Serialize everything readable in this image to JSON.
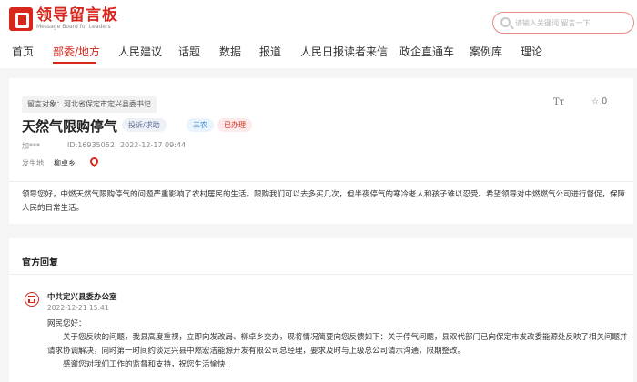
{
  "header": {
    "logo_title": "领导留言板",
    "logo_subtitle": "Message Board for Leaders",
    "search": {
      "placeholder": "请输入关键词 留言一下"
    }
  },
  "nav": [
    {
      "label": "首页",
      "active": false
    },
    {
      "label": "部委/地方",
      "active": true
    },
    {
      "label": "人民建议",
      "active": false
    },
    {
      "label": "话题",
      "active": false
    },
    {
      "label": "数据",
      "active": false
    },
    {
      "label": "报道",
      "active": false
    },
    {
      "label": "人民日报读者来信",
      "active": false
    },
    {
      "label": "政企直通车",
      "active": false
    },
    {
      "label": "案例库",
      "active": false
    },
    {
      "label": "理论",
      "active": false
    }
  ],
  "letter": {
    "target": "留言对象：河北省保定市定兴县委书记",
    "title": "天然气限购停气",
    "tags": [
      "投诉/求助",
      "三农",
      "已办理"
    ],
    "font_size_icon": "Tт",
    "favorite_icon_label": "0",
    "author": "加***",
    "id": "ID:16935052",
    "time": "2022-12-17 09:44",
    "location_label": "发生地",
    "location_value": "柳卓乡",
    "content": "领导您好，中燃天然气限购停气的问题严重影响了农村居民的生活。限购我们可以去多买几次，但半夜停气的寒冷老人和孩子难以忍受。希望领导对中燃燃气公司进行督促，保障人民的日常生活。"
  },
  "reply": {
    "heading": "官方回复",
    "org": "中共定兴县委办公室",
    "time": "2022-12-21 15:41",
    "greeting": "网民您好：",
    "body": "关于您反映的问题，我县高度重视，立即向发改局、柳卓乡交办，现将情况简要向您反馈如下：关于停气问题，县双代部门已向保定市发改委能源处反映了相关问题并请求协调解决，同时第一时间约谈定兴县中燃宏洁能源开发有限公司总经理，要求及时与上级总公司请示沟通，限期整改。",
    "closing": "感谢您对我们工作的监督和支持，祝您生活愉快！"
  },
  "colors": {
    "brand": "#d7261c"
  }
}
